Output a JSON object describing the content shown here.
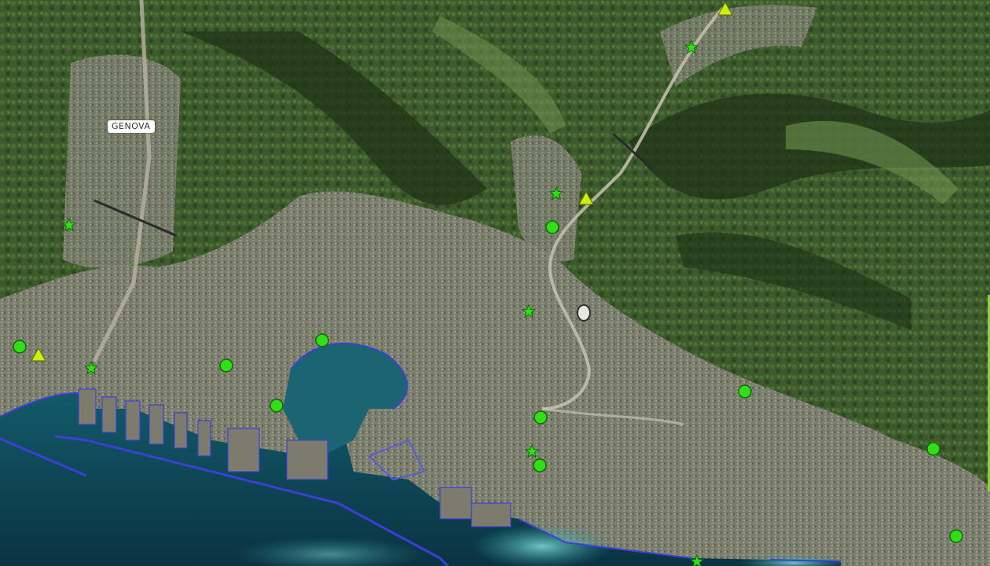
{
  "map": {
    "city_label": "GENOVA",
    "colors": {
      "sea_deep": "#0c3d4f",
      "sea_shallow": "#2d8f96",
      "urban": "#8a8a7a",
      "hills": "#3e5a2a",
      "coastline": "#3e3ed8",
      "marker_fill": "#33dd1a",
      "marker_stroke": "#0a6b00",
      "triangle_fill": "#ccee11"
    },
    "legend_marker_types": [
      "circle-marker",
      "star-marker",
      "triangle-marker"
    ]
  }
}
